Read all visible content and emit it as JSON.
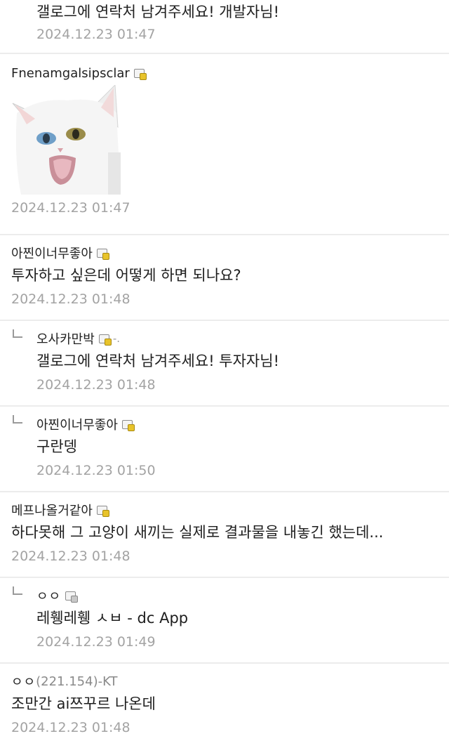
{
  "comments": [
    {
      "type": "reply",
      "text": "갤로그에 연락처 남겨주세요! 개발자님!",
      "date": "2024.12.23 01:47"
    },
    {
      "type": "comment",
      "author": "Fnenamgalsipsclar",
      "image": "white-cat-sticker",
      "date": "2024.12.23 01:47"
    },
    {
      "type": "comment",
      "author": "아찐이너무좋아",
      "text": "투자하고 싶은데 어떻게 하면 되나요?",
      "date": "2024.12.23 01:48"
    },
    {
      "type": "reply",
      "author": "오사카만박",
      "author_suffix": "-.",
      "text": "갤로그에 연락처 남겨주세요! 투자자님!",
      "date": "2024.12.23 01:48"
    },
    {
      "type": "reply",
      "author": "아찐이너무좋아",
      "text": "구란뎅",
      "date": "2024.12.23 01:50"
    },
    {
      "type": "comment",
      "author": "메프나올거같아",
      "text": "하다못해 그 고양이 새끼는 실제로 결과물을 내놓긴 했는데...",
      "date": "2024.12.23 01:48"
    },
    {
      "type": "reply",
      "author": "ㅇㅇ",
      "text": "레휑레휑 ㅅㅂ - dc App",
      "date": "2024.12.23 01:49"
    },
    {
      "type": "comment",
      "author": "ㅇㅇ",
      "author_ip": "(221.154)-KT",
      "text": "조만간 ai쯔꾸르 나온데",
      "date": "2024.12.23 01:48"
    }
  ],
  "colors": {
    "divider": "#ececec",
    "date": "#a3a3a3",
    "badge_gold": "#e8c32a"
  },
  "icons": {
    "badge": "fixed-nick-badge-icon",
    "reply": "reply-arrow-icon"
  }
}
